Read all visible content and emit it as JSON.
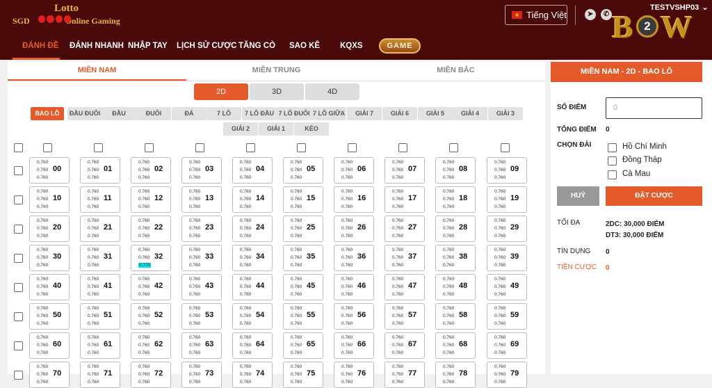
{
  "logo": {
    "line1": "Lotto",
    "line2": "SGD",
    "line3": "Online Gaming"
  },
  "header": {
    "language": "Tiếng Việt",
    "user": "TESTVSHP03",
    "brand_left": "B",
    "brand_mid": "2",
    "brand_right": "W",
    "chevron": "⌄"
  },
  "nav": {
    "items": [
      "ĐÁNH ĐỀ",
      "ĐÁNH NHANH",
      "NHẬP TAY",
      "LỊCH SỬ CƯỢC",
      "TĂNG CÒ",
      "SAO KÊ",
      "KQXS"
    ],
    "game": "GAME"
  },
  "regions": [
    "MIỀN NAM",
    "MIỀN TRUNG",
    "MIỀN BẮC"
  ],
  "digits": [
    "2D",
    "3D",
    "4D"
  ],
  "bet_types": [
    "BAO LÔ",
    "ĐẦU ĐUÔI",
    "ĐẦU",
    "ĐUÔI",
    "ĐÁ",
    "7 LÔ",
    "7 LÔ ĐẦU",
    "7 LÔ ĐUÔI",
    "7 LÔ GIỮA",
    "GIẢI 7",
    "GIẢI 6",
    "GIẢI 5",
    "GIẢI 4",
    "GIẢI 3",
    "GIẢI 2",
    "GIẢI 1",
    "KÉO"
  ],
  "odds": {
    "default": "0.760",
    "highlighted": "0.770"
  },
  "numbers": [
    "00",
    "01",
    "02",
    "03",
    "04",
    "05",
    "06",
    "07",
    "08",
    "09",
    "10",
    "11",
    "12",
    "13",
    "14",
    "15",
    "16",
    "17",
    "18",
    "19",
    "20",
    "21",
    "22",
    "23",
    "24",
    "25",
    "26",
    "27",
    "28",
    "29",
    "30",
    "31",
    "32",
    "33",
    "34",
    "35",
    "36",
    "37",
    "38",
    "39",
    "40",
    "41",
    "42",
    "43",
    "44",
    "45",
    "46",
    "47",
    "48",
    "49",
    "50",
    "51",
    "52",
    "53",
    "54",
    "55",
    "56",
    "57",
    "58",
    "59",
    "60",
    "61",
    "62",
    "63",
    "64",
    "65",
    "66",
    "67",
    "68",
    "69",
    "70",
    "71",
    "72",
    "73",
    "74",
    "75",
    "76",
    "77",
    "78",
    "79"
  ],
  "side": {
    "title": "MIỀN NAM - 2D - BAO LÔ",
    "so_diem_label": "SỐ ĐIỂM",
    "so_diem_placeholder": "0",
    "tong_diem_label": "TỔNG ĐIỂM",
    "tong_diem_value": "0",
    "chon_dai_label": "CHỌN ĐÀI",
    "dai": [
      "Hồ Chí Minh",
      "Đồng Tháp",
      "Cà Mau"
    ],
    "huy": "HUỶ",
    "dat_cuoc": "ĐẶT CƯỢC",
    "toi_da_label": "TỐI ĐA",
    "toi_da_1": "2DC: 30,000 ĐIỂM",
    "toi_da_2": "DT3: 30,000 ĐIỂM",
    "tin_dung_label": "TÍN DỤNG",
    "tin_dung_value": "0",
    "tien_cuoc_label": "TIỀN CƯỢC",
    "tien_cuoc_value": "0"
  },
  "colors": {
    "header_bg": "#4a0a0a",
    "accent": "#e55a2a",
    "highlight": "#00e5e5"
  }
}
